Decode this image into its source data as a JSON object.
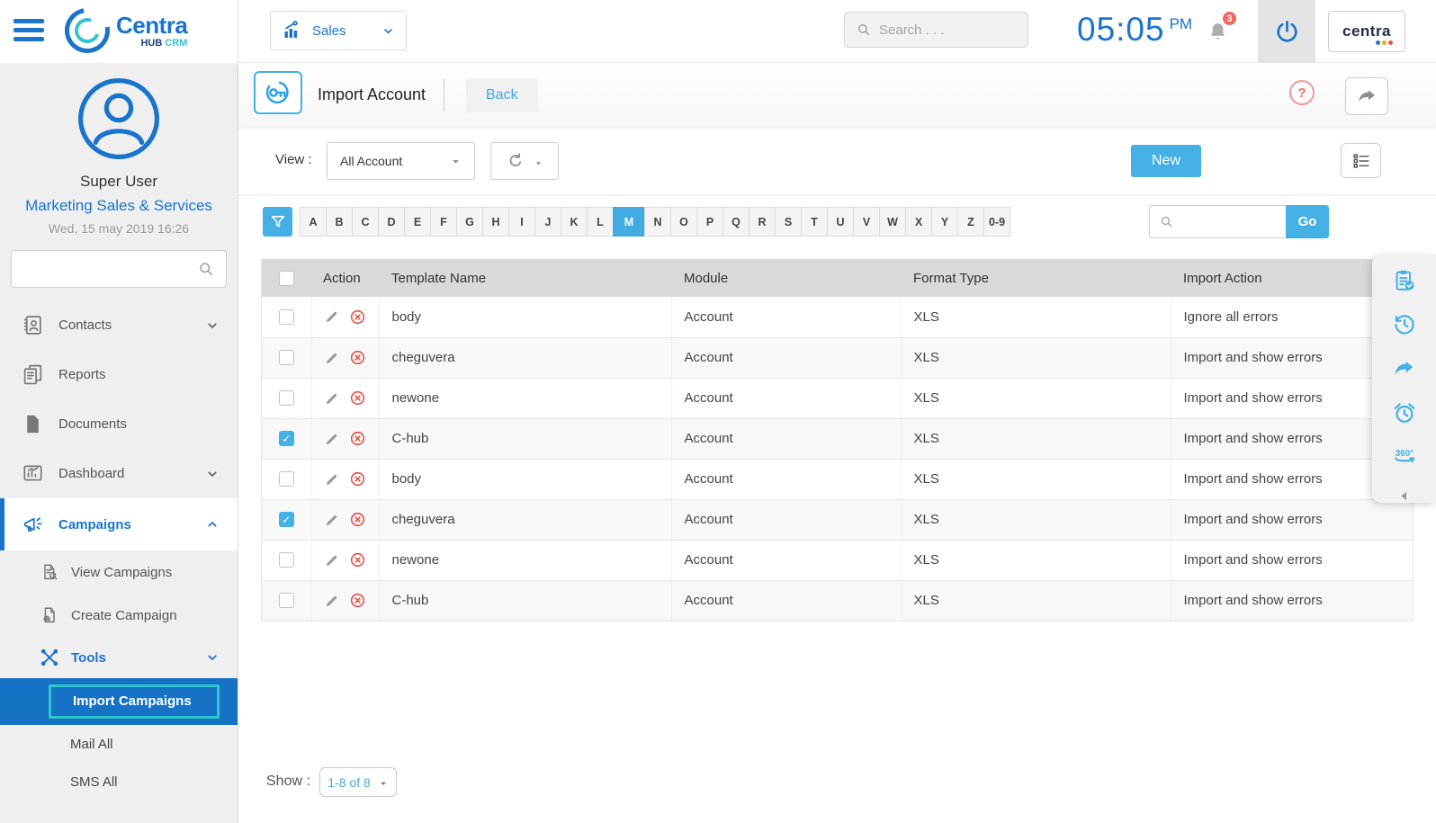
{
  "colors": {
    "accent": "#1b74cc",
    "light_blue": "#45b0e5",
    "selected_row": "#1572c4",
    "teal_highlight": "#2fc5cf",
    "red": "#e0514a",
    "brand_dots": [
      "#2f6fb8",
      "#f2a51d",
      "#e0514a"
    ]
  },
  "logo": {
    "title": "Centra",
    "sub_hub": "HUB",
    "sub_crm": "CRM"
  },
  "topbar": {
    "module_label": "Sales",
    "search_placeholder": "Search . . .",
    "time": "05:05",
    "period": "PM",
    "notifications": "3",
    "brand": "centra"
  },
  "sidebar": {
    "user_name": "Super User",
    "department": "Marketing Sales & Services",
    "datetime": "Wed, 15 may 2019 16:26",
    "menu": [
      {
        "label": "Contacts",
        "icon": "contacts",
        "chevron": "down",
        "indent": 0
      },
      {
        "label": "Reports",
        "icon": "reports",
        "indent": 0
      },
      {
        "label": "Documents",
        "icon": "documents",
        "indent": 0
      },
      {
        "label": "Dashboard",
        "icon": "dashboard",
        "chevron": "down",
        "indent": 0
      },
      {
        "label": "Campaigns",
        "icon": "campaigns",
        "chevron": "up",
        "indent": 0,
        "active": true
      },
      {
        "label": "View Campaigns",
        "icon": "view-campaigns",
        "indent": 1
      },
      {
        "label": "Create Campaign",
        "icon": "create-campaign",
        "indent": 1
      },
      {
        "label": "Tools",
        "icon": "tools",
        "chevron": "down",
        "indent": 1,
        "emphasis": true
      },
      {
        "label": "Import Campaigns",
        "indent": 2,
        "selected": true
      },
      {
        "label": "Mail All",
        "indent": 2
      },
      {
        "label": "SMS All",
        "indent": 2
      }
    ]
  },
  "page": {
    "title": "Import Account",
    "back": "Back",
    "help": "?"
  },
  "toolbar": {
    "view_label": "View :",
    "view_value": "All Account",
    "new_label": "New"
  },
  "alphabet": {
    "letters": [
      "A",
      "B",
      "C",
      "D",
      "E",
      "F",
      "G",
      "H",
      "I",
      "J",
      "K",
      "L",
      "M",
      "N",
      "O",
      "P",
      "Q",
      "R",
      "S",
      "T",
      "U",
      "V",
      "W",
      "X",
      "Y",
      "Z",
      "0-9"
    ],
    "selected": "M",
    "go": "Go"
  },
  "table": {
    "columns": [
      "Action",
      "Template Name",
      "Module",
      "Format Type",
      "Import Action"
    ],
    "rows": [
      {
        "checked": false,
        "template": "body",
        "module": "Account",
        "format": "XLS",
        "action": "Ignore all errors"
      },
      {
        "checked": false,
        "template": "cheguvera",
        "module": "Account",
        "format": "XLS",
        "action": "Import and show errors"
      },
      {
        "checked": false,
        "template": "newone",
        "module": "Account",
        "format": "XLS",
        "action": "Import and show errors"
      },
      {
        "checked": true,
        "template": "C-hub",
        "module": "Account",
        "format": "XLS",
        "action": "Import and show errors"
      },
      {
        "checked": false,
        "template": "body",
        "module": "Account",
        "format": "XLS",
        "action": "Import and show errors"
      },
      {
        "checked": true,
        "template": "cheguvera",
        "module": "Account",
        "format": "XLS",
        "action": "Import and show errors"
      },
      {
        "checked": false,
        "template": "newone",
        "module": "Account",
        "format": "XLS",
        "action": "Import and show errors"
      },
      {
        "checked": false,
        "template": "C-hub",
        "module": "Account",
        "format": "XLS",
        "action": "Import and show errors"
      }
    ]
  },
  "pagination": {
    "label": "Show :",
    "value": "1-8 of 8"
  },
  "side_panel": {
    "icons": [
      "clipboard-check",
      "history",
      "share",
      "alarm",
      "deg360"
    ]
  }
}
